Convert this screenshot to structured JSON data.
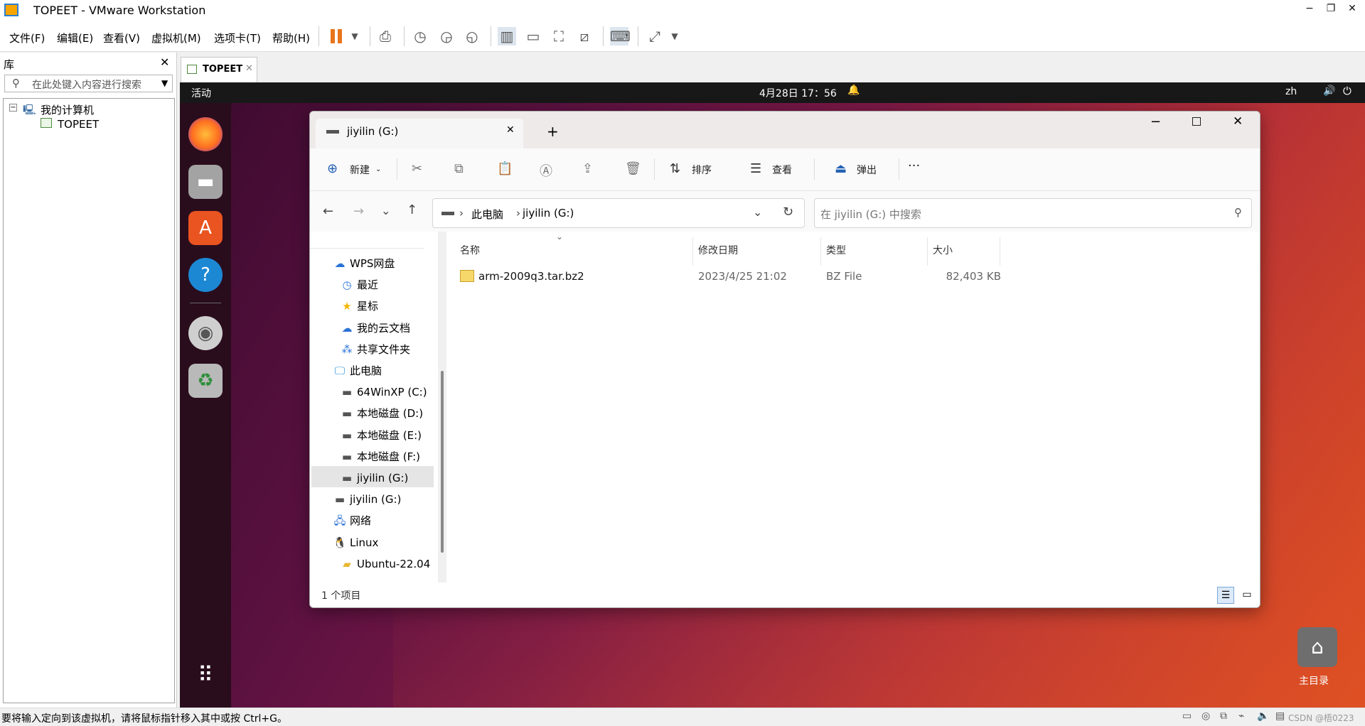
{
  "app": {
    "title": "TOPEET - VMware Workstation",
    "minimize": "−",
    "restore": "❐",
    "close": "✕"
  },
  "menu": [
    "文件(F)",
    "编辑(E)",
    "查看(V)",
    "虚拟机(M)",
    "选项卡(T)",
    "帮助(H)"
  ],
  "library": {
    "title": "库",
    "close": "✕",
    "search_placeholder": "在此处键入内容进行搜索",
    "root": "我的计算机",
    "vm": "TOPEET"
  },
  "vm_tab": {
    "label": "TOPEET",
    "close": "✕"
  },
  "gnome": {
    "activities": "活动",
    "clock": "4月28日 17：56",
    "lang": "zh"
  },
  "desktop": {
    "home_label": "主目录"
  },
  "explorer": {
    "tab_title": "jiyilin (G:)",
    "tab_close": "✕",
    "new_tab": "+",
    "toolbar": {
      "new": "新建",
      "sort": "排序",
      "view": "查看",
      "eject": "弹出",
      "more": "···"
    },
    "breadcrumb": [
      "此电脑",
      "jiyilin (G:)"
    ],
    "search_placeholder": "在 jiyilin (G:) 中搜索",
    "nav": [
      {
        "label": "WPS网盘",
        "icon": "cloud-icon",
        "indent": 0
      },
      {
        "label": "最近",
        "icon": "clock-icon",
        "indent": 1
      },
      {
        "label": "星标",
        "icon": "star-icon",
        "indent": 1
      },
      {
        "label": "我的云文档",
        "icon": "cloud-doc-icon",
        "indent": 1
      },
      {
        "label": "共享文件夹",
        "icon": "share-icon",
        "indent": 1
      },
      {
        "label": "此电脑",
        "icon": "monitor-icon",
        "indent": 0
      },
      {
        "label": "64WinXP  (C:)",
        "icon": "drive-icon",
        "indent": 1
      },
      {
        "label": "本地磁盘 (D:)",
        "icon": "drive-icon",
        "indent": 1
      },
      {
        "label": "本地磁盘 (E:)",
        "icon": "drive-icon",
        "indent": 1
      },
      {
        "label": "本地磁盘 (F:)",
        "icon": "drive-icon",
        "indent": 1
      },
      {
        "label": "jiyilin (G:)",
        "icon": "drive-icon",
        "indent": 1
      },
      {
        "label": "jiyilin (G:)",
        "icon": "drive-icon",
        "indent": 0
      },
      {
        "label": "网络",
        "icon": "network-icon",
        "indent": 0
      },
      {
        "label": "Linux",
        "icon": "linux-icon",
        "indent": 0
      },
      {
        "label": "Ubuntu-22.04",
        "icon": "folder-icon",
        "indent": 1
      }
    ],
    "columns": {
      "name": "名称",
      "date": "修改日期",
      "type": "类型",
      "size": "大小"
    },
    "files": [
      {
        "name": "arm-2009q3.tar.bz2",
        "date": "2023/4/25 21:02",
        "type": "BZ File",
        "size": "82,403 KB"
      }
    ],
    "status": "1 个项目"
  },
  "status_bar": {
    "message": "要将输入定向到该虚拟机，请将鼠标指针移入其中或按 Ctrl+G。",
    "watermark": "CSDN @梧0223"
  }
}
